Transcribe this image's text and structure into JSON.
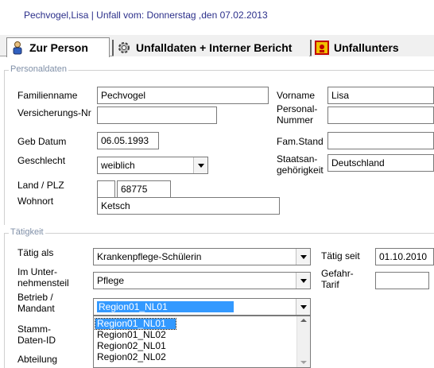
{
  "window": {
    "title": "Pechvogel,Lisa | Unfall vom: Donnerstag ,den 07.02.2013"
  },
  "tabs": [
    {
      "label": "Zur Person",
      "icon": "person-icon"
    },
    {
      "label": "Unfalldaten + Interner Bericht",
      "icon": "gear-icon"
    },
    {
      "label": "Unfallunters",
      "icon": "warning-sign-icon"
    }
  ],
  "personal": {
    "group_label": "Personaldaten",
    "familienname_label": "Familienname",
    "familienname_value": "Pechvogel",
    "vorname_label": "Vorname",
    "vorname_value": "Lisa",
    "versnr_label": "Versicherungs-Nr",
    "versnr_value": "",
    "personalnr_label_1": "Personal-",
    "personalnr_label_2": "Nummer",
    "personalnr_value": "",
    "gebdatum_label": "Geb Datum",
    "gebdatum_value": "06.05.1993",
    "famstand_label": "Fam.Stand",
    "famstand_value": "",
    "geschlecht_label": "Geschlecht",
    "geschlecht_value": "weiblich",
    "staats_label_1": "Staatsan-",
    "staats_label_2": "gehörigkeit",
    "staats_value": "Deutschland",
    "landplz_label": "Land / PLZ",
    "land_value": "",
    "plz_value": "68775",
    "wohnort_label": "Wohnort",
    "wohnort_value": "Ketsch"
  },
  "taetigkeit": {
    "group_label": "Tätigkeit",
    "taetig_als_label": "Tätig als",
    "taetig_als_value": "Krankenpflege-Schülerin",
    "taetig_seit_label": "Tätig seit",
    "taetig_seit_value": "01.10.2010",
    "unternehmensteil_label_1": "Im Unter-",
    "unternehmensteil_label_2": "nehmensteil",
    "unternehmensteil_value": "Pflege",
    "gefahr_label_1": "Gefahr-",
    "gefahr_label_2": "Tarif",
    "gefahr_value": "",
    "betrieb_label_1": "Betrieb /",
    "betrieb_label_2": "Mandant",
    "betrieb_value": "Region01_NL01",
    "stamm_label_1": "Stamm-",
    "stamm_label_2": "Daten-ID",
    "abteilung_label": "Abteilung",
    "dropdown_options": [
      "Region01_NL01",
      "Region01_NL02",
      "Region02_NL01",
      "Region02_NL02"
    ]
  }
}
